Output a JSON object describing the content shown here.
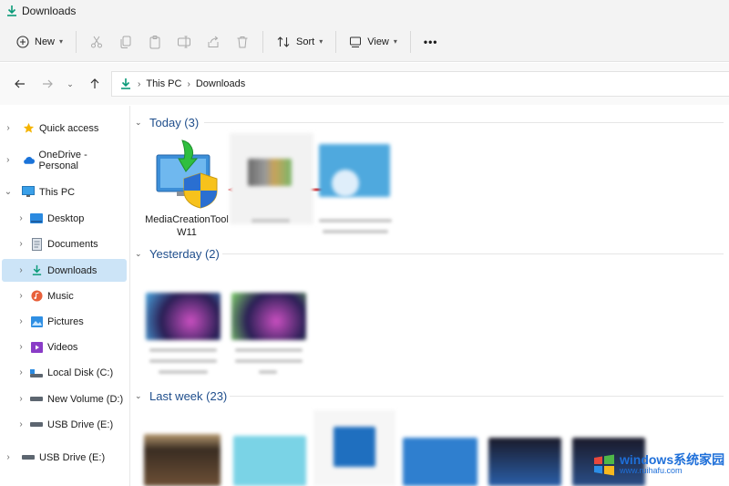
{
  "window": {
    "title": "Downloads"
  },
  "commandbar": {
    "new_label": "New",
    "sort_label": "Sort",
    "view_label": "View",
    "more_label": "•••"
  },
  "address": {
    "crumbs": [
      "This PC",
      "Downloads"
    ]
  },
  "sidebar": {
    "items": [
      {
        "label": "Quick access",
        "icon": "star-icon"
      },
      {
        "label": "OneDrive - Personal",
        "icon": "cloud-icon"
      },
      {
        "label": "This PC",
        "icon": "monitor-icon"
      },
      {
        "label": "Desktop",
        "icon": "desktop-icon"
      },
      {
        "label": "Documents",
        "icon": "document-icon"
      },
      {
        "label": "Downloads",
        "icon": "download-icon"
      },
      {
        "label": "Music",
        "icon": "music-icon"
      },
      {
        "label": "Pictures",
        "icon": "picture-icon"
      },
      {
        "label": "Videos",
        "icon": "video-icon"
      },
      {
        "label": "Local Disk (C:)",
        "icon": "drive-icon"
      },
      {
        "label": "New Volume (D:)",
        "icon": "drive-icon"
      },
      {
        "label": "USB Drive (E:)",
        "icon": "usb-drive-icon"
      },
      {
        "label": "USB Drive (E:)",
        "icon": "usb-drive-icon"
      }
    ]
  },
  "content": {
    "groups": [
      {
        "label": "Today (3)"
      },
      {
        "label": "Yesterday (2)"
      },
      {
        "label": "Last week (23)"
      }
    ],
    "highlighted_file": {
      "name": "MediaCreationToolW11"
    }
  },
  "watermark": {
    "line1": "windows系统家园",
    "line2": "www.ruihafu.com"
  },
  "colors": {
    "accent": "#0067c0",
    "selection": "#cce4f7",
    "arrow": "#d9383a",
    "group_header": "#1f4e8c"
  }
}
